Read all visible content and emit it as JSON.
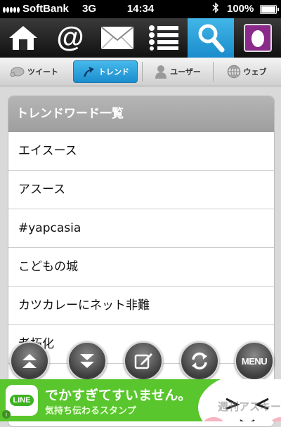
{
  "status_bar": {
    "carrier": "SoftBank",
    "network": "3G",
    "time": "14:34",
    "battery": "100%"
  },
  "top_nav": {
    "items": [
      {
        "icon": "home-icon"
      },
      {
        "icon": "at-mention-icon"
      },
      {
        "icon": "mail-icon"
      },
      {
        "icon": "list-icon"
      },
      {
        "icon": "search-icon",
        "active": true
      },
      {
        "icon": "profile-icon"
      }
    ]
  },
  "tabs": [
    {
      "label": "ツイート",
      "icon": "tweet-bubble-icon"
    },
    {
      "label": "トレンド",
      "icon": "trend-arrow-icon",
      "selected": true
    },
    {
      "label": "ユーザー",
      "icon": "user-icon"
    },
    {
      "label": "ウェブ",
      "icon": "globe-icon"
    }
  ],
  "trend_list": {
    "header": "トレンドワード一覧",
    "items": [
      "エイスース",
      "アスース",
      "#yapcasia",
      "こどもの城",
      "カツカレーにネット非難",
      "老朽化"
    ]
  },
  "bottom_actions": {
    "menu_label": "MENU",
    "buttons": [
      "scroll-top-icon",
      "scroll-bottom-icon",
      "compose-icon",
      "refresh-icon",
      "menu"
    ]
  },
  "ad_banner": {
    "logo_text": "LINE",
    "headline": "でかすぎてすいません。",
    "subline": "気持ち伝わるスタンプ",
    "watermark": "週刊アスキー"
  },
  "colors": {
    "accent": "#2aa0dc",
    "ad_green": "#58c62c",
    "header_gray": "#a8a8a8"
  }
}
